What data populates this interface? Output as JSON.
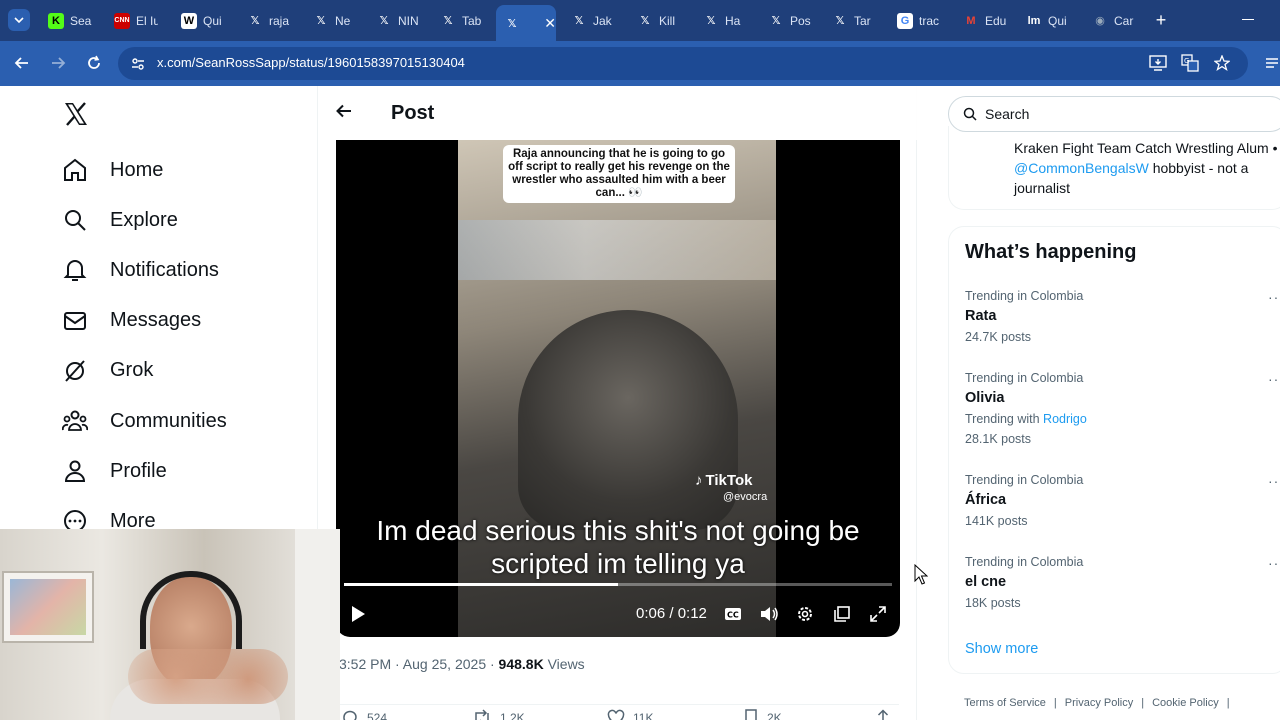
{
  "browser": {
    "tabs": [
      {
        "title": "Sea",
        "icon": "kick-icon",
        "icon_text": "K",
        "color": "#53fc18",
        "fg": "#000"
      },
      {
        "title": "El Iu",
        "icon": "cnn-icon",
        "icon_text": "CNN",
        "color": "#cc0000",
        "fg": "#fff"
      },
      {
        "title": "Qui",
        "icon": "wikipedia-icon",
        "icon_text": "W",
        "color": "#ffffff",
        "fg": "#000"
      },
      {
        "title": "raja",
        "icon": "x-icon",
        "icon_text": "𝕏",
        "color": "transparent",
        "fg": "#fff"
      },
      {
        "title": "Ne",
        "icon": "x-icon",
        "icon_text": "𝕏",
        "color": "transparent",
        "fg": "#fff"
      },
      {
        "title": "NIN",
        "icon": "x-icon",
        "icon_text": "𝕏",
        "color": "transparent",
        "fg": "#fff"
      },
      {
        "title": "Tab",
        "icon": "x-icon",
        "icon_text": "𝕏",
        "color": "transparent",
        "fg": "#fff"
      },
      {
        "title": "",
        "icon": "x-icon",
        "icon_text": "𝕏",
        "color": "transparent",
        "fg": "#fff",
        "active": true
      },
      {
        "title": "Jak",
        "icon": "x-icon",
        "icon_text": "𝕏",
        "color": "transparent",
        "fg": "#fff"
      },
      {
        "title": "Kill",
        "icon": "x-icon",
        "icon_text": "𝕏",
        "color": "transparent",
        "fg": "#fff"
      },
      {
        "title": "Ha",
        "icon": "x-icon",
        "icon_text": "𝕏",
        "color": "transparent",
        "fg": "#fff"
      },
      {
        "title": "Pos",
        "icon": "x-icon",
        "icon_text": "𝕏",
        "color": "transparent",
        "fg": "#fff"
      },
      {
        "title": "Tar",
        "icon": "x-icon",
        "icon_text": "𝕏",
        "color": "transparent",
        "fg": "#fff"
      },
      {
        "title": "trac",
        "icon": "google-icon",
        "icon_text": "G",
        "color": "#ffffff",
        "fg": "#4285f4"
      },
      {
        "title": "Edu",
        "icon": "gmail-icon",
        "icon_text": "M",
        "color": "transparent",
        "fg": "#ea4335"
      },
      {
        "title": "Qui",
        "icon": "quizlet-icon",
        "icon_text": "lm",
        "color": "transparent",
        "fg": "#fff"
      },
      {
        "title": "Car",
        "icon": "globe-icon",
        "icon_text": "◉",
        "color": "transparent",
        "fg": "#9ab"
      }
    ],
    "url": "x.com/SeanRossSapp/status/1960158397015130404"
  },
  "nav": {
    "items": [
      {
        "label": "Home",
        "icon": "home-icon"
      },
      {
        "label": "Explore",
        "icon": "search-icon"
      },
      {
        "label": "Notifications",
        "icon": "bell-icon"
      },
      {
        "label": "Messages",
        "icon": "envelope-icon"
      },
      {
        "label": "Grok",
        "icon": "grok-icon"
      },
      {
        "label": "Communities",
        "icon": "people-icon"
      },
      {
        "label": "Profile",
        "icon": "person-icon"
      },
      {
        "label": "More",
        "icon": "more-circle-icon"
      }
    ]
  },
  "post": {
    "header_title": "Post",
    "video": {
      "caption": "Raja announcing that he is going to go off script to really get his revenge on the wrestler who assaulted him with a beer can... 👀",
      "watermark_brand": "TikTok",
      "watermark_handle": "@evocra",
      "subtitle_line1": "Im dead serious this shit's not going be",
      "subtitle_line2": "scripted im telling ya",
      "time": "0:06 / 0:12",
      "progress": 0.5
    },
    "meta_time": "3:52 PM · Aug 25, 2025 · ",
    "meta_views_count": "948.8K",
    "meta_views_label": " Views",
    "actions": {
      "replies": "524",
      "reposts": "1.2K",
      "likes": "11K",
      "bookmarks": "2K"
    }
  },
  "right": {
    "search_placeholder": "Search",
    "bio_text_1": "Kraken Fight Team Catch Wrestling Alum • ",
    "bio_link": "@CommonBengalsW",
    "bio_text_2": " hobbyist - not a journalist",
    "happening_title": "What’s happening",
    "trends": [
      {
        "context": "Trending in Colombia",
        "name": "Rata",
        "count": "24.7K posts"
      },
      {
        "context": "Trending in Colombia",
        "name": "Olivia",
        "with_label": "Trending with ",
        "with_link": "Rodrigo",
        "count": "28.1K posts"
      },
      {
        "context": "Trending in Colombia",
        "name": "África",
        "count": "141K posts"
      },
      {
        "context": "Trending in Colombia",
        "name": "el cne",
        "count": "18K posts"
      }
    ],
    "show_more": "Show more",
    "footer": [
      "Terms of Service",
      "|",
      "Privacy Policy",
      "|",
      "Cookie Policy",
      "|"
    ]
  }
}
